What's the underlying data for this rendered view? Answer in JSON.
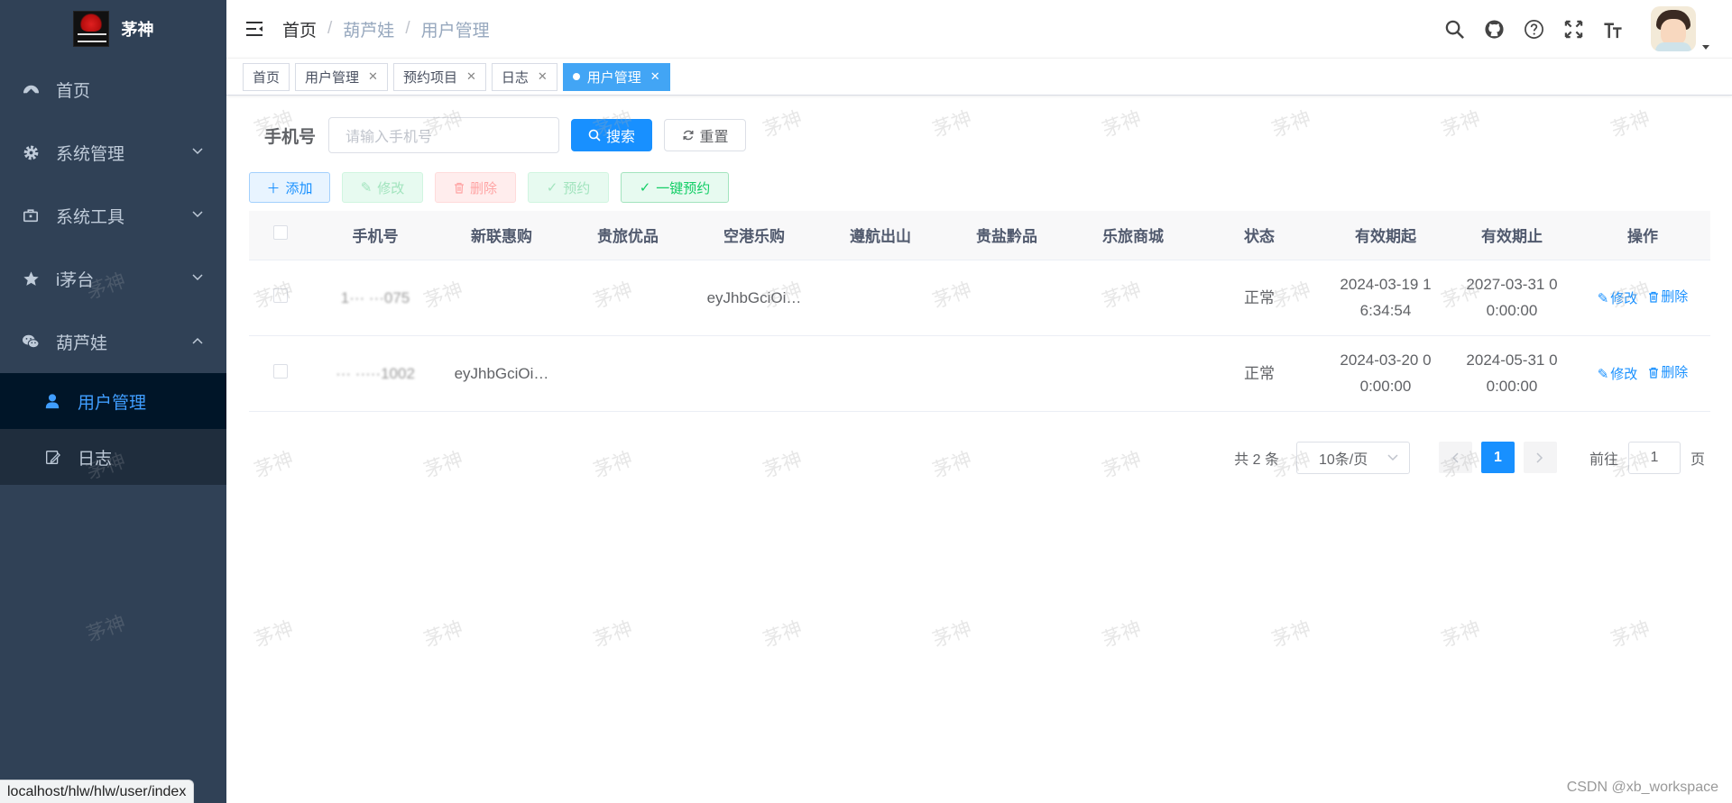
{
  "app": {
    "title": "茅神"
  },
  "sidebar": {
    "items": [
      {
        "label": "首页",
        "icon": "dashboard-icon"
      },
      {
        "label": "系统管理",
        "icon": "gear-icon",
        "expandable": true
      },
      {
        "label": "系统工具",
        "icon": "toolbox-icon",
        "expandable": true
      },
      {
        "label": "i茅台",
        "icon": "star-icon",
        "expandable": true
      },
      {
        "label": "葫芦娃",
        "icon": "wechat-icon",
        "expandable": true,
        "expanded": true
      }
    ],
    "sub_items": [
      {
        "label": "用户管理",
        "icon": "user-icon",
        "active": true
      },
      {
        "label": "日志",
        "icon": "edit-icon",
        "active": false
      }
    ]
  },
  "status_url": "localhost/hlw/hlw/user/index",
  "breadcrumb": [
    "首页",
    "葫芦娃",
    "用户管理"
  ],
  "tags": [
    {
      "label": "首页",
      "closable": false,
      "active": false
    },
    {
      "label": "用户管理",
      "closable": true,
      "active": false
    },
    {
      "label": "预约项目",
      "closable": true,
      "active": false
    },
    {
      "label": "日志",
      "closable": true,
      "active": false
    },
    {
      "label": "用户管理",
      "closable": true,
      "active": true
    }
  ],
  "search": {
    "label": "手机号",
    "placeholder": "请输入手机号",
    "search_btn": "搜索",
    "reset_btn": "重置"
  },
  "toolbar": {
    "add": "添加",
    "edit": "修改",
    "delete": "删除",
    "book": "预约",
    "onekey": "一键预约"
  },
  "table": {
    "columns": [
      "手机号",
      "新联惠购",
      "贵旅优品",
      "空港乐购",
      "遵航出山",
      "贵盐黔品",
      "乐旅商城",
      "状态",
      "有效期起",
      "有效期止",
      "操作"
    ],
    "rows": [
      {
        "phone": "1··· ···075",
        "c1": "",
        "c2": "",
        "c3": "eyJhbGciOi…",
        "c4": "",
        "c5": "",
        "c6": "",
        "status": "正常",
        "start": [
          "2024-03-19 1",
          "6:34:54"
        ],
        "end": [
          "2027-03-31 0",
          "0:00:00"
        ]
      },
      {
        "phone": "··· ·····1002",
        "c1": "eyJhbGciOi…",
        "c2": "",
        "c3": "",
        "c4": "",
        "c5": "",
        "c6": "",
        "status": "正常",
        "start": [
          "2024-03-20 0",
          "0:00:00"
        ],
        "end": [
          "2024-05-31 0",
          "0:00:00"
        ]
      }
    ],
    "op_edit": "修改",
    "op_delete": "删除"
  },
  "pagination": {
    "total": "共 2 条",
    "page_size": "10条/页",
    "current": "1",
    "goto_label": "前往",
    "goto_value": "1",
    "goto_unit": "页"
  },
  "watermark": "茅神",
  "footer_credit": "CSDN @xb_workspace",
  "colors": {
    "sidebar_bg": "#304156",
    "primary": "#1890ff",
    "active_tag": "#42a5f5"
  }
}
